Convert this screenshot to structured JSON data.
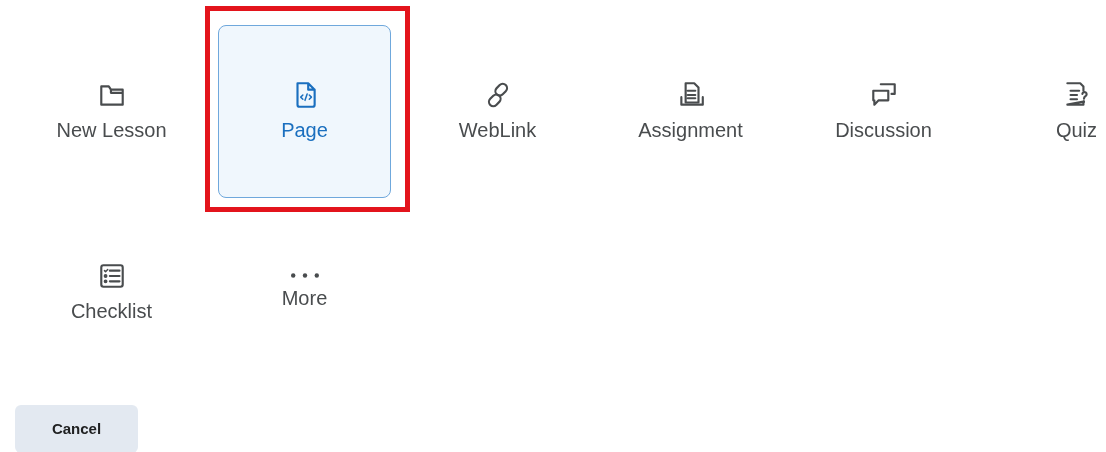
{
  "items": [
    {
      "kind": "folder",
      "label": "New Lesson",
      "selected": false
    },
    {
      "kind": "page",
      "label": "Page",
      "selected": true
    },
    {
      "kind": "link",
      "label": "WebLink",
      "selected": false
    },
    {
      "kind": "assignment",
      "label": "Assignment",
      "selected": false
    },
    {
      "kind": "discussion",
      "label": "Discussion",
      "selected": false
    },
    {
      "kind": "quiz",
      "label": "Quiz",
      "selected": false
    },
    {
      "kind": "checklist",
      "label": "Checklist",
      "selected": false
    },
    {
      "kind": "more",
      "label": "More",
      "selected": false
    }
  ],
  "buttons": [
    "Cancel"
  ]
}
